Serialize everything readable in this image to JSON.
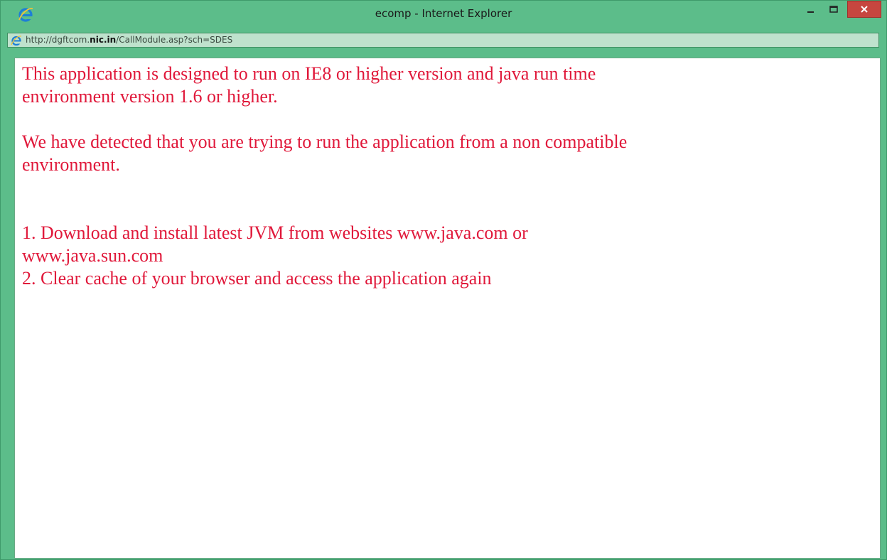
{
  "window": {
    "title": "ecomp - Internet Explorer",
    "browser_icon": "internet-explorer-icon",
    "controls": {
      "minimize": "minimize-icon",
      "maximize": "maximize-icon",
      "close": "close-icon"
    }
  },
  "address": {
    "prefix": "http://dgftcom.",
    "domain": "nic.in",
    "path": "/CallModule.asp?sch=SDES"
  },
  "message": {
    "para1": {
      "line1": "This application is designed to run on IE8 or higher version and java run time",
      "line2": "environment version 1.6 or higher."
    },
    "para2": {
      "line1": "We have detected that you are trying to run the application from a non compatible",
      "line2": "environment."
    },
    "steps": {
      "line1": "1. Download and install latest JVM from websites www.java.com or",
      "line2": "www.java.sun.com",
      "line3": "2. Clear cache of your browser and access the application again"
    }
  },
  "colors": {
    "frame": "#5cbd8a",
    "close_button": "#c7463f",
    "message_text": "#e0183a"
  }
}
